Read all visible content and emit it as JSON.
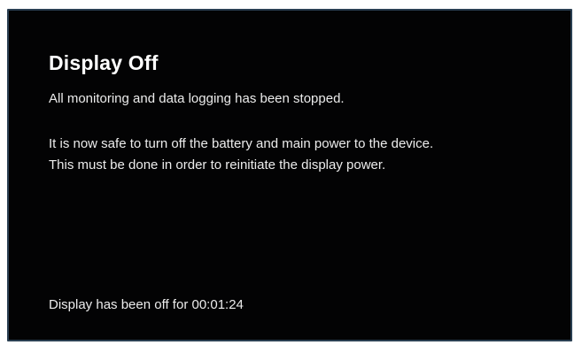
{
  "screen": {
    "title": "Display Off",
    "message_stopped": "All monitoring and data logging has been stopped.",
    "message_safe": "It is now safe to turn off the battery and main power to the device.",
    "message_reinit": "This must be done in order to reinitiate the display power.",
    "status_prefix": "Display has been off for",
    "elapsed_time": "00:01:24"
  },
  "colors": {
    "background": "#030304",
    "border": "#2a3f52",
    "text": "#ececec"
  }
}
